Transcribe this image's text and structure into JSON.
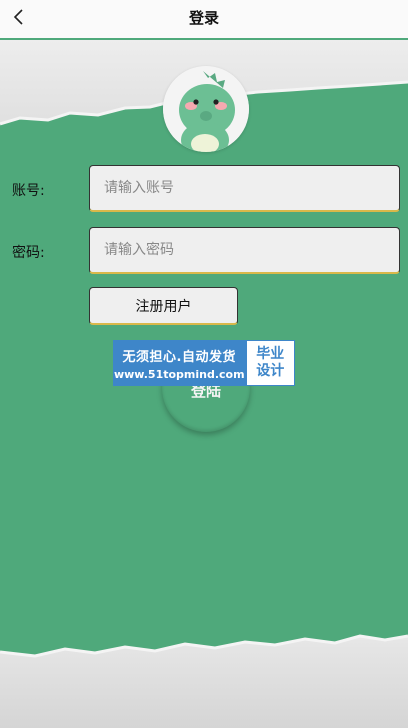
{
  "header": {
    "title": "登录",
    "back_icon": "chevron-left-icon"
  },
  "form": {
    "account": {
      "label": "账号:",
      "placeholder": "请输入账号",
      "value": ""
    },
    "password": {
      "label": "密码:",
      "placeholder": "请输入密码",
      "value": ""
    },
    "register_label": "注册用户",
    "login_label": "登陆"
  },
  "avatar": {
    "icon": "dinosaur-mascot-icon"
  },
  "watermark": {
    "line1": "无须担心.自动发货",
    "line2": "www.51topmind.com",
    "badge_line1": "毕业",
    "badge_line2": "设计"
  },
  "colors": {
    "accent": "#4fa97b",
    "field_bg": "#efefef",
    "field_underline": "#d9b84a",
    "watermark_blue": "#3e86c9"
  }
}
